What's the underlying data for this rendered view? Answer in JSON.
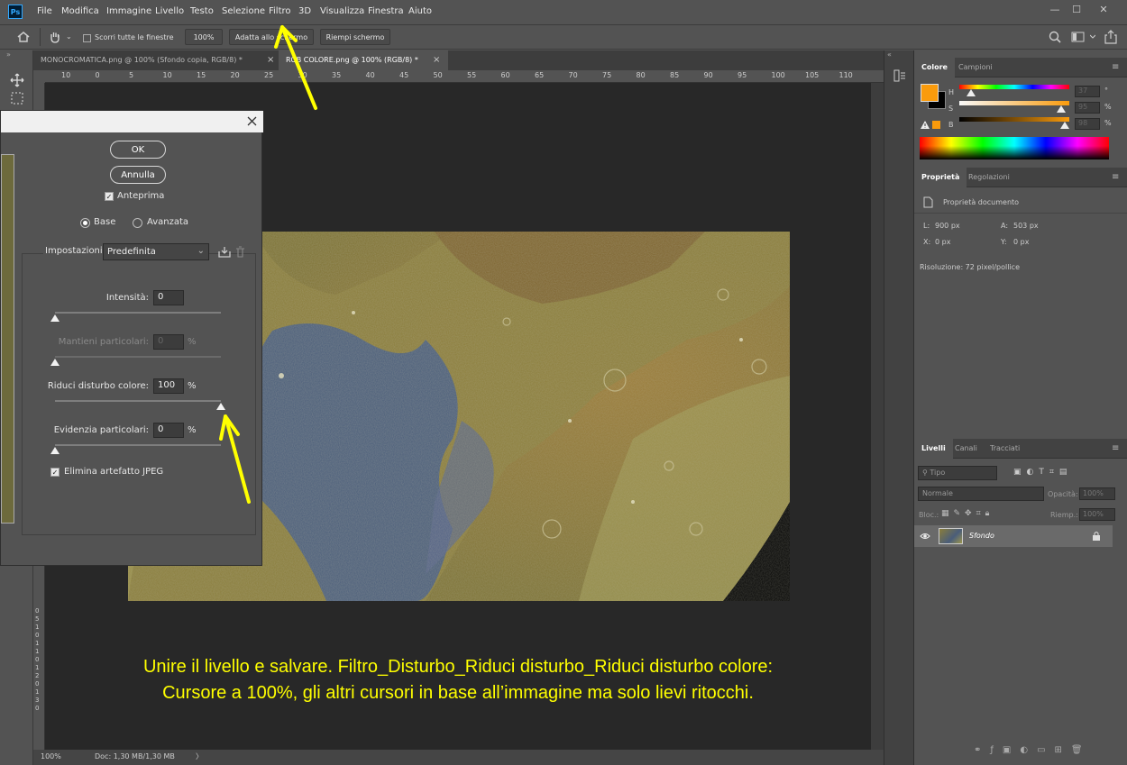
{
  "menubar": {
    "logo": "Ps",
    "items": [
      "File",
      "Modifica",
      "Immagine",
      "Livello",
      "Testo",
      "Selezione",
      "Filtro",
      "3D",
      "Visualizza",
      "Finestra",
      "Aiuto"
    ],
    "window_controls": [
      "—",
      "☐",
      "✕"
    ]
  },
  "options": {
    "scroll_all_label": "Scorri tutte le finestre",
    "zoom_value": "100%",
    "fit_screen_label": "Adatta allo schermo",
    "fill_screen_label": "Riempi schermo"
  },
  "tabs": {
    "doc1": "MONOCROMATICA.png @ 100% (Sfondo copia, RGB/8) *",
    "doc2": "RGB COLORE.png @ 100% (RGB/8) *",
    "close": "×"
  },
  "ruler": {
    "top_ticks": [
      "10",
      "0",
      "5",
      "10",
      "15",
      "20",
      "25",
      "30",
      "35",
      "40",
      "45",
      "50",
      "55",
      "60",
      "65",
      "70",
      "75",
      "80",
      "85",
      "90",
      "95",
      "100",
      "105",
      "110"
    ],
    "left_ticks": [
      "0",
      "5",
      "1",
      "0",
      "1",
      "1",
      "0",
      "1",
      "2",
      "0",
      "1",
      "3",
      "0"
    ]
  },
  "status": {
    "zoom": "100%",
    "doc": "Doc: 1,30 MB/1,30 MB",
    "arrow": "〉"
  },
  "dialog": {
    "ok_label": "OK",
    "cancel_label": "Annulla",
    "preview_label": "Anteprima",
    "mode_basic": "Base",
    "mode_advanced": "Avanzata",
    "settings_label": "Impostazioni:",
    "settings_value": "Predefinita",
    "sliders": [
      {
        "label": "Intensità:",
        "value": "0",
        "unit": "",
        "level": 0,
        "disabled": false
      },
      {
        "label": "Mantieni particolari:",
        "value": "0",
        "unit": "%",
        "level": 0,
        "disabled": true
      },
      {
        "label": "Riduci disturbo colore:",
        "value": "100",
        "unit": "%",
        "level": 1,
        "disabled": false
      },
      {
        "label": "Evidenzia particolari:",
        "value": "0",
        "unit": "%",
        "level": 0,
        "disabled": false
      }
    ],
    "jpeg_label": "Elimina artefatto JPEG"
  },
  "color_panel": {
    "tab_active": "Colore",
    "tab_other": "Campioni",
    "h_label": "H",
    "s_label": "S",
    "b_label": "B",
    "h_value": "37",
    "s_value": "95",
    "b_value": "98",
    "h_unit": "°",
    "s_unit": "%",
    "b_unit": "%",
    "fg_color": "#fa9b0c"
  },
  "properties_panel": {
    "tab_active": "Proprietà",
    "tab_other": "Regolazioni",
    "doc_props": "Proprietà documento",
    "w_label": "L:",
    "w_value": "900 px",
    "h_label": "A:",
    "h_value": "503 px",
    "x_label": "X:",
    "x_value": "0 px",
    "y_label": "Y:",
    "y_value": "0 px",
    "resolution": "Risoluzione: 72 pixel/pollice"
  },
  "layers_panel": {
    "tabs": [
      "Livelli",
      "Canali",
      "Tracciati"
    ],
    "kind_placeholder": "Tipo",
    "blend_mode": "Normale",
    "opacity_label": "Opacità:",
    "opacity_value": "100%",
    "lock_label": "Bloc.:",
    "fill_label": "Riemp.:",
    "fill_value": "100%",
    "layer_name": "Sfondo"
  },
  "caption": {
    "line1": "Unire il livello e salvare. Filtro_Disturbo_Riduci disturbo_Riduci disturbo colore:",
    "line2": "Cursore a 100%, gli altri cursori in base all’immagine ma solo lievi ritocchi."
  },
  "colors": {
    "annotation": "#ffff00",
    "ui_bg": "#535353",
    "canvas_bg": "#282828"
  }
}
